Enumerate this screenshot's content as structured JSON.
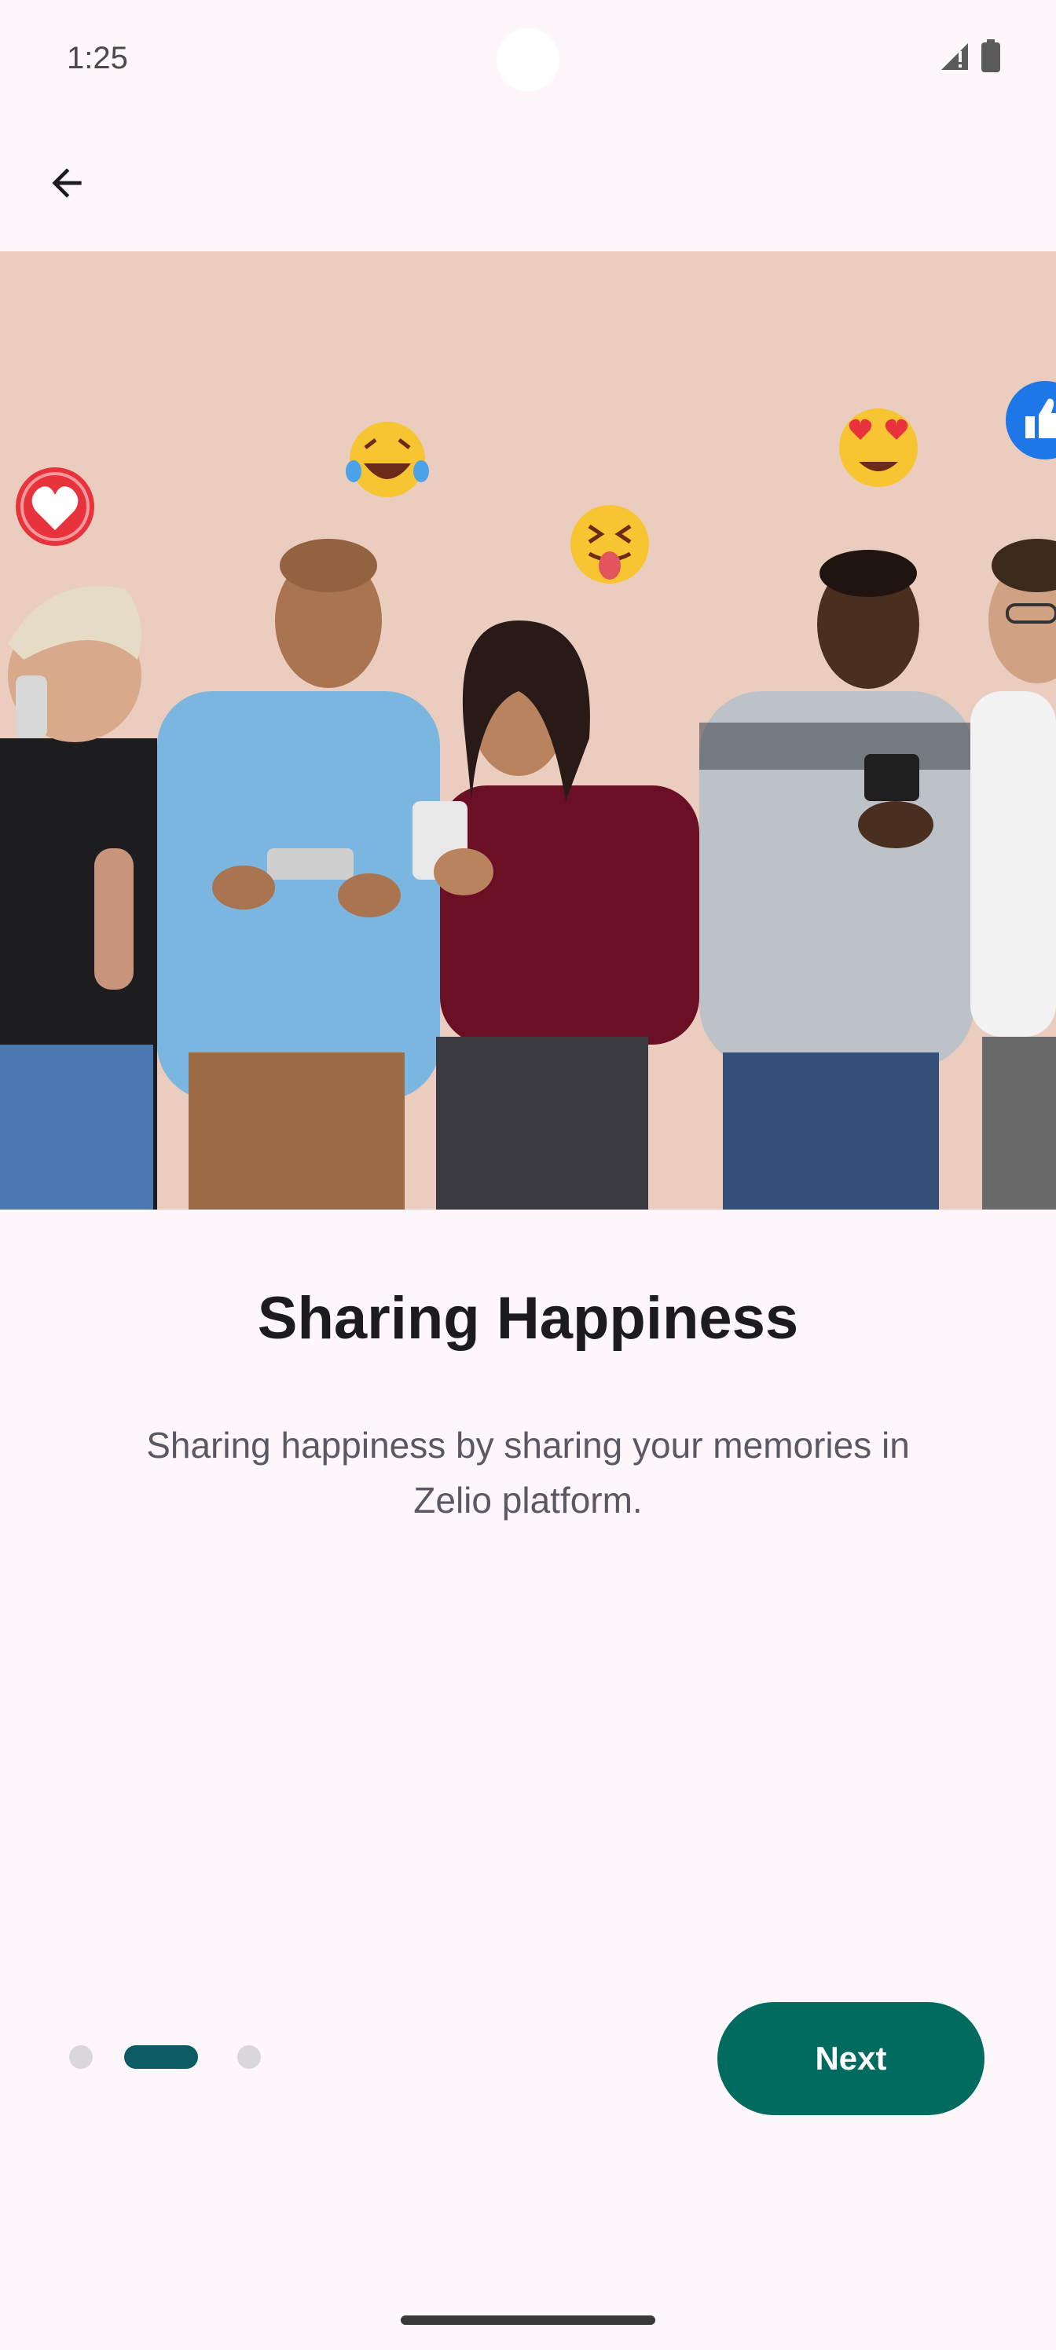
{
  "status_bar": {
    "time": "1:25",
    "icons": [
      "signal-icon",
      "battery-icon"
    ]
  },
  "app_bar": {
    "back_icon": "arrow-back-icon"
  },
  "hero": {
    "image_description_icon": "people-with-phones-illustration",
    "reactions": [
      "heart-reaction-icon",
      "laughing-emoji-icon",
      "tongue-emoji-icon",
      "heart-eyes-emoji-icon",
      "thumbs-up-reaction-icon"
    ]
  },
  "content": {
    "title": "Sharing Happiness",
    "description": "Sharing happiness by sharing your memories in Zelio platform."
  },
  "pager": {
    "page_count": 3,
    "current_page": 2,
    "next_label": "Next"
  },
  "colors": {
    "background": "#fdf6fb",
    "accent": "#006b5e",
    "indicator_active": "#0d5c63",
    "indicator_inactive": "#d9d6dc",
    "hero_bg": "#ebcdc0"
  }
}
